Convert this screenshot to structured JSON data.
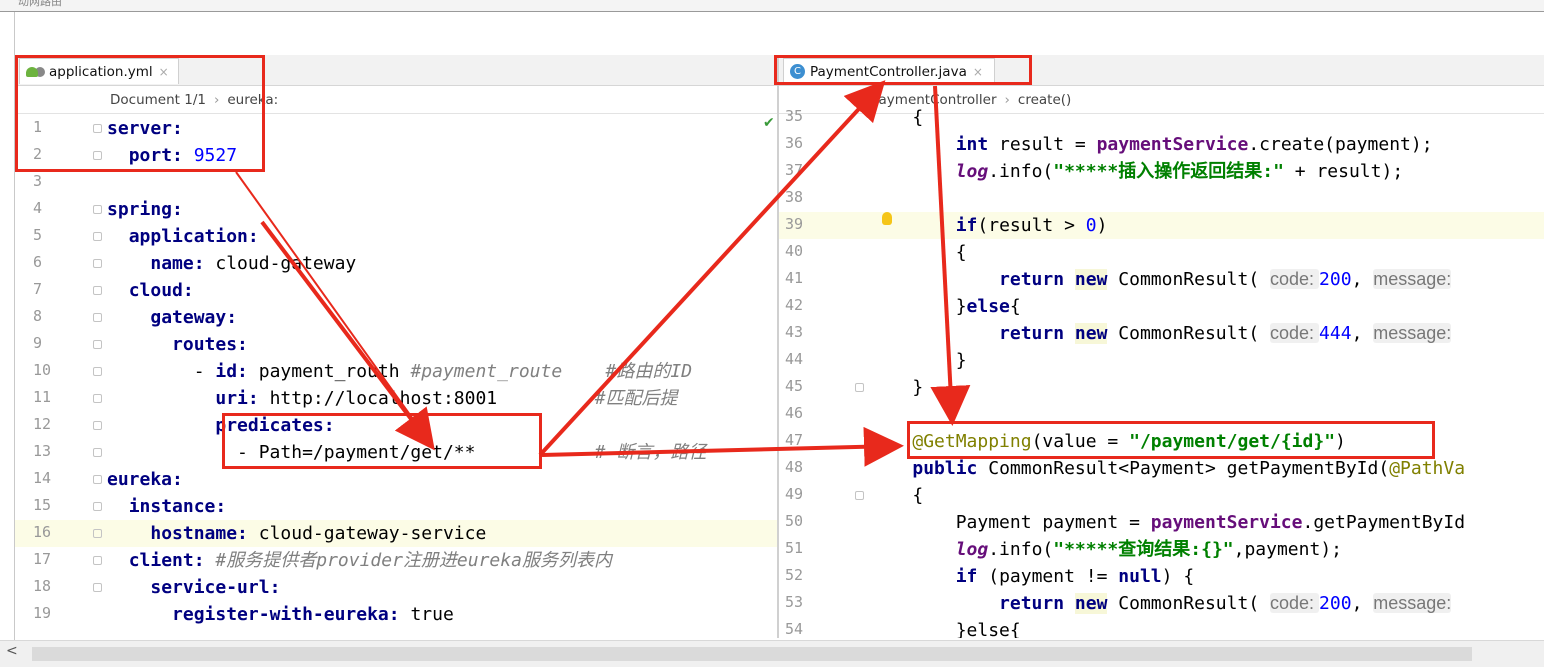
{
  "window": {
    "title_fragment": "动网路由"
  },
  "left_editor": {
    "tab": {
      "label": "application.yml",
      "close": "×"
    },
    "breadcrumb": [
      "Document 1/1",
      "eureka:"
    ],
    "lines": [
      {
        "n": "1",
        "segs": [
          [
            "k",
            "server:"
          ]
        ]
      },
      {
        "n": "2",
        "segs": [
          [
            "p",
            "  "
          ],
          [
            "k",
            "port:"
          ],
          [
            "p",
            " "
          ],
          [
            "num",
            "9527"
          ]
        ]
      },
      {
        "n": "3",
        "segs": []
      },
      {
        "n": "4",
        "segs": [
          [
            "k",
            "spring:"
          ]
        ]
      },
      {
        "n": "5",
        "segs": [
          [
            "p",
            "  "
          ],
          [
            "k",
            "application:"
          ]
        ]
      },
      {
        "n": "6",
        "segs": [
          [
            "p",
            "    "
          ],
          [
            "k",
            "name:"
          ],
          [
            "p",
            " cloud-gateway"
          ]
        ]
      },
      {
        "n": "7",
        "segs": [
          [
            "p",
            "  "
          ],
          [
            "k",
            "cloud:"
          ]
        ]
      },
      {
        "n": "8",
        "segs": [
          [
            "p",
            "    "
          ],
          [
            "k",
            "gateway:"
          ]
        ]
      },
      {
        "n": "9",
        "segs": [
          [
            "p",
            "      "
          ],
          [
            "k",
            "routes:"
          ]
        ]
      },
      {
        "n": "10",
        "segs": [
          [
            "p",
            "        - "
          ],
          [
            "k",
            "id:"
          ],
          [
            "p",
            " payment_routh "
          ],
          [
            "cm",
            "#payment_route    #路由的ID"
          ]
        ]
      },
      {
        "n": "11",
        "segs": [
          [
            "p",
            "          "
          ],
          [
            "k",
            "uri:"
          ],
          [
            "p",
            " http://localhost:8001         "
          ],
          [
            "cm",
            "#匹配后提"
          ]
        ]
      },
      {
        "n": "12",
        "segs": [
          [
            "p",
            "          "
          ],
          [
            "k",
            "predicates:"
          ]
        ]
      },
      {
        "n": "13",
        "segs": [
          [
            "p",
            "            - Path=/payment/get/**           "
          ],
          [
            "cm",
            "# 断言，路径"
          ]
        ]
      },
      {
        "n": "14",
        "segs": [
          [
            "k",
            "eureka:"
          ]
        ]
      },
      {
        "n": "15",
        "segs": [
          [
            "p",
            "  "
          ],
          [
            "k",
            "instance:"
          ]
        ]
      },
      {
        "n": "16",
        "segs": [
          [
            "p",
            "    "
          ],
          [
            "k",
            "hostname:"
          ],
          [
            "p",
            " cloud-gateway-service"
          ]
        ]
      },
      {
        "n": "17",
        "segs": [
          [
            "p",
            "  "
          ],
          [
            "k",
            "client:"
          ],
          [
            "p",
            " "
          ],
          [
            "cm",
            "#服务提供者provider注册进eureka服务列表内"
          ]
        ]
      },
      {
        "n": "18",
        "segs": [
          [
            "p",
            "    "
          ],
          [
            "k",
            "service-url:"
          ]
        ]
      },
      {
        "n": "19",
        "segs": [
          [
            "p",
            "      "
          ],
          [
            "k",
            "register-with-eureka:"
          ],
          [
            "p",
            " true"
          ]
        ]
      }
    ]
  },
  "right_editor": {
    "tab": {
      "label": "PaymentController.java",
      "close": "×"
    },
    "breadcrumb": [
      "PaymentController",
      "create()"
    ],
    "lines": [
      {
        "n": "35",
        "segs": [
          [
            "p",
            "    {"
          ]
        ]
      },
      {
        "n": "36",
        "segs": [
          [
            "p",
            "        "
          ],
          [
            "kw",
            "int"
          ],
          [
            "p",
            " result = "
          ],
          [
            "fld",
            "paymentService"
          ],
          [
            "p",
            ".create(payment);"
          ]
        ]
      },
      {
        "n": "37",
        "segs": [
          [
            "p",
            "        "
          ],
          [
            "itf",
            "log"
          ],
          [
            "p",
            ".info("
          ],
          [
            "str",
            "\"*****插入操作返回结果:\""
          ],
          [
            "p",
            " + result);"
          ]
        ]
      },
      {
        "n": "38",
        "segs": []
      },
      {
        "n": "39",
        "segs": [
          [
            "p",
            "        "
          ],
          [
            "kw",
            "if"
          ],
          [
            "p",
            "(result > "
          ],
          [
            "num",
            "0"
          ],
          [
            "p",
            ")"
          ]
        ]
      },
      {
        "n": "40",
        "segs": [
          [
            "p",
            "        {"
          ]
        ]
      },
      {
        "n": "41",
        "segs": [
          [
            "p",
            "            "
          ],
          [
            "kw",
            "return"
          ],
          [
            "p",
            " "
          ],
          [
            "newkw",
            "new"
          ],
          [
            "p",
            " CommonResult( "
          ],
          [
            "hint",
            "code: "
          ],
          [
            "hintv",
            "200"
          ],
          [
            "p",
            ", "
          ],
          [
            "hint",
            "message:"
          ]
        ]
      },
      {
        "n": "42",
        "segs": [
          [
            "p",
            "        }"
          ],
          [
            "kw",
            "else"
          ],
          [
            "p",
            "{"
          ]
        ]
      },
      {
        "n": "43",
        "segs": [
          [
            "p",
            "            "
          ],
          [
            "kw",
            "return"
          ],
          [
            "p",
            " "
          ],
          [
            "newkw",
            "new"
          ],
          [
            "p",
            " CommonResult( "
          ],
          [
            "hint",
            "code: "
          ],
          [
            "hintv",
            "444"
          ],
          [
            "p",
            ", "
          ],
          [
            "hint",
            "message:"
          ]
        ]
      },
      {
        "n": "44",
        "segs": [
          [
            "p",
            "        }"
          ]
        ]
      },
      {
        "n": "45",
        "segs": [
          [
            "p",
            "    }"
          ]
        ]
      },
      {
        "n": "46",
        "segs": []
      },
      {
        "n": "47",
        "segs": [
          [
            "p",
            "    "
          ],
          [
            "ann",
            "@GetMapping"
          ],
          [
            "p",
            "(value = "
          ],
          [
            "str",
            "\"/payment/get/{id}\""
          ],
          [
            "p",
            ")"
          ]
        ]
      },
      {
        "n": "48",
        "segs": [
          [
            "p",
            "    "
          ],
          [
            "kw",
            "public"
          ],
          [
            "p",
            " CommonResult<Payment> getPaymentById("
          ],
          [
            "ann",
            "@PathVa"
          ]
        ]
      },
      {
        "n": "49",
        "segs": [
          [
            "p",
            "    {"
          ]
        ]
      },
      {
        "n": "50",
        "segs": [
          [
            "p",
            "        Payment payment = "
          ],
          [
            "fld",
            "paymentService"
          ],
          [
            "p",
            ".getPaymentById"
          ]
        ]
      },
      {
        "n": "51",
        "segs": [
          [
            "p",
            "        "
          ],
          [
            "itf",
            "log"
          ],
          [
            "p",
            ".info("
          ],
          [
            "str",
            "\"*****查询结果:{}\""
          ],
          [
            "p",
            ",payment);"
          ]
        ]
      },
      {
        "n": "52",
        "segs": [
          [
            "p",
            "        "
          ],
          [
            "kw",
            "if"
          ],
          [
            "p",
            " (payment != "
          ],
          [
            "kw",
            "null"
          ],
          [
            "p",
            ") {"
          ]
        ]
      },
      {
        "n": "53",
        "segs": [
          [
            "p",
            "            "
          ],
          [
            "kw",
            "return"
          ],
          [
            "p",
            " "
          ],
          [
            "newkw",
            "new"
          ],
          [
            "p",
            " CommonResult( "
          ],
          [
            "hint",
            "code: "
          ],
          [
            "hintv",
            "200"
          ],
          [
            "p",
            ", "
          ],
          [
            "hint",
            "message:"
          ]
        ]
      },
      {
        "n": "54",
        "segs": [
          [
            "p",
            "        }else{"
          ]
        ]
      }
    ]
  },
  "scrollbar": {
    "left_arrow": "<"
  }
}
